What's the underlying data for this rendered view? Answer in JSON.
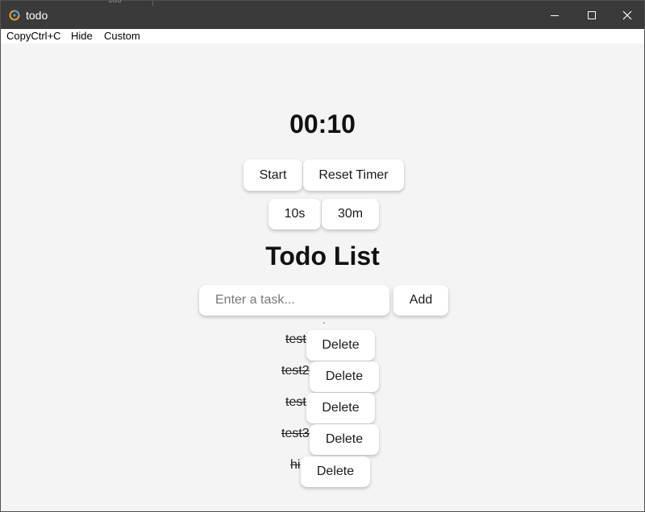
{
  "window": {
    "title": "todo",
    "ghost_tab_text": "183"
  },
  "menu": {
    "items": [
      "CopyCtrl+C",
      "Hide",
      "Custom"
    ]
  },
  "timer": {
    "display": "00:10",
    "start_label": "Start",
    "reset_label": "Reset Timer",
    "preset_10s": "10s",
    "preset_30m": "30m"
  },
  "todo": {
    "heading": "Todo List",
    "input_placeholder": "Enter a task...",
    "input_value": "",
    "add_label": "Add",
    "delete_label": "Delete",
    "items": [
      {
        "text": "test",
        "completed": true
      },
      {
        "text": "test2",
        "completed": true
      },
      {
        "text": "test",
        "completed": true
      },
      {
        "text": "test3",
        "completed": true
      },
      {
        "text": "hi",
        "completed": true
      }
    ]
  },
  "colors": {
    "titlebar": "#3a3a3a",
    "background": "#f4f4f4",
    "button": "#ffffff"
  }
}
